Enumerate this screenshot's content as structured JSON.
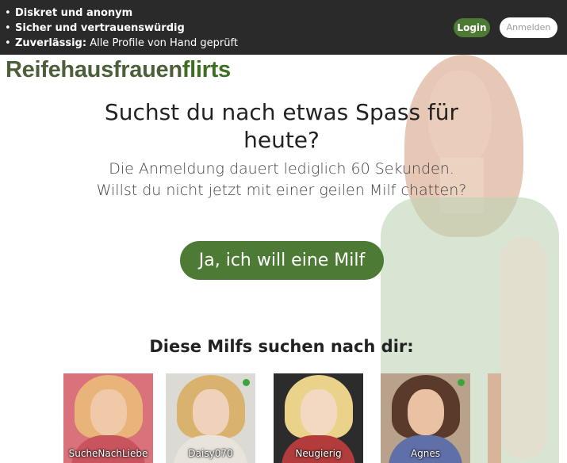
{
  "topbar": {
    "usps": [
      {
        "bold": "Diskret und anonym",
        "rest": ""
      },
      {
        "bold": "Sicher und vertrauenswürdig",
        "rest": ""
      },
      {
        "bold": "Zuverlässig:",
        "rest": " Alle Profile von Hand geprüft"
      }
    ],
    "login_label": "Login",
    "register_label": "Anmelden"
  },
  "logo": {
    "part1": "Reifehausfrauen",
    "part2": "flirts"
  },
  "hero": {
    "headline": "Suchst du nach etwas Spass für heute?",
    "subline": "Die Anmeldung dauert lediglich 60 Sekunden. Willst du nicht jetzt mit einer geilen Milf chatten?",
    "cta_label": "Ja, ich will eine Milf"
  },
  "profiles": {
    "title": "Diese Milfs suchen nach dir:",
    "items": [
      {
        "name": "SucheNachLiebe",
        "online": false
      },
      {
        "name": "Daisy070",
        "online": true
      },
      {
        "name": "Neugierig",
        "online": false
      },
      {
        "name": "Agnes",
        "online": true
      }
    ]
  },
  "colors": {
    "topbar_bg": "#2a2a2a",
    "accent_green": "#4d7a35",
    "online_dot": "#3aa53a"
  },
  "icons": {
    "online": "online-status-dot"
  }
}
